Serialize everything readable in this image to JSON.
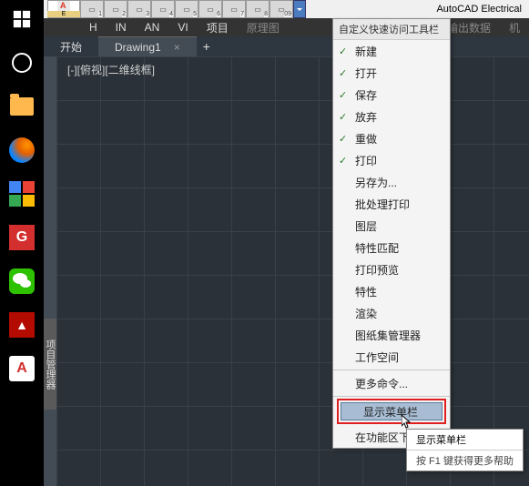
{
  "title": "AutoCAD Electrical",
  "app_icon_label": "E",
  "qat": [
    "1",
    "2",
    "3",
    "4",
    "5",
    "6",
    "7",
    "8",
    "09"
  ],
  "menubar": {
    "home": "H",
    "in": "IN",
    "an": "AN",
    "vi": "VI",
    "proj": "项目",
    "schematic": "原理图",
    "io": "/输出数据",
    "mach": "机"
  },
  "tabs": {
    "start": "开始",
    "drawing": "Drawing1",
    "plus": "+"
  },
  "view_label": "[-][俯视][二维线框]",
  "side_tab": "项目管理器",
  "dropdown": {
    "header": "自定义快速访问工具栏",
    "checked": [
      "新建",
      "打开",
      "保存",
      "放弃",
      "重做",
      "打印"
    ],
    "unchecked": [
      "另存为...",
      "批处理打印",
      "图层",
      "特性匹配",
      "打印预览",
      "特性",
      "渲染",
      "图纸集管理器",
      "工作空间"
    ],
    "more": "更多命令...",
    "show_menu": "显示菜单栏",
    "below": "在功能区下方显示"
  },
  "tooltip": {
    "title": "显示菜单栏",
    "help": "按 F1 键获得更多帮助"
  }
}
